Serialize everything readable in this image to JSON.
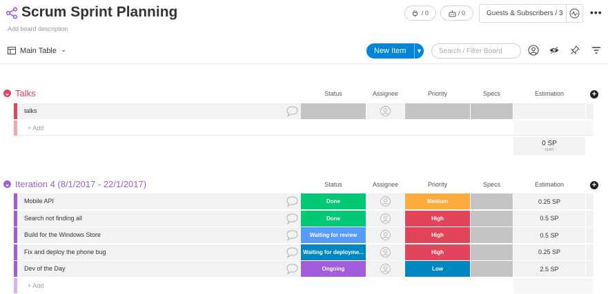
{
  "header": {
    "title": "Scrum Sprint Planning",
    "description": "Add board description",
    "integrations_count": "/ 0",
    "automations_count": "/ 0",
    "guests_label": "Guests & Subscribers / 3",
    "more_label": "•••"
  },
  "toolbar": {
    "view_label": "Main Table",
    "new_item_label": "New Item",
    "search_placeholder": "Search / Filter Board"
  },
  "columns": {
    "status": "Status",
    "assignee": "Assignee",
    "priority": "Priority",
    "specs": "Specs",
    "estimation": "Estimation"
  },
  "add_label": "+ Add",
  "colors": {
    "talks": "#e2445c",
    "talks_light": "#f4a7b3",
    "iteration": "#a25ddc",
    "iteration_light": "#d6b5f0",
    "done": "#00c875",
    "medium": "#fdab3d",
    "high": "#e2445c",
    "low": "#0086c0",
    "waiting_review": "#579bfc",
    "waiting_deploy": "#0086c0",
    "ongoing": "#a25ddc",
    "empty": "#c4c4c4",
    "primary": "#0086d6"
  },
  "groups": [
    {
      "title": "Talks",
      "sum_value": "0 SP",
      "sum_label": "sum",
      "rows": [
        {
          "name": "talks",
          "status": "",
          "priority": "",
          "estimation": ""
        }
      ]
    },
    {
      "title": "Iteration 4 (8/1/2017 - 22/1/2017)",
      "rows": [
        {
          "name": "Mobile API",
          "status": "Done",
          "priority": "Medium",
          "estimation": "0.25 SP"
        },
        {
          "name": "Search not finding all",
          "status": "Done",
          "priority": "High",
          "estimation": "0.5 SP"
        },
        {
          "name": "Build for the Windows Store",
          "status": "Waiting for review",
          "priority": "High",
          "estimation": "0.5 SP"
        },
        {
          "name": "Fix and deploy the phone bug",
          "status": "Waiting for deployme...",
          "priority": "High",
          "estimation": "0.25 SP"
        },
        {
          "name": "Dev of the Day",
          "status": "Ongoing",
          "priority": "Low",
          "estimation": "2.5 SP"
        }
      ]
    }
  ]
}
